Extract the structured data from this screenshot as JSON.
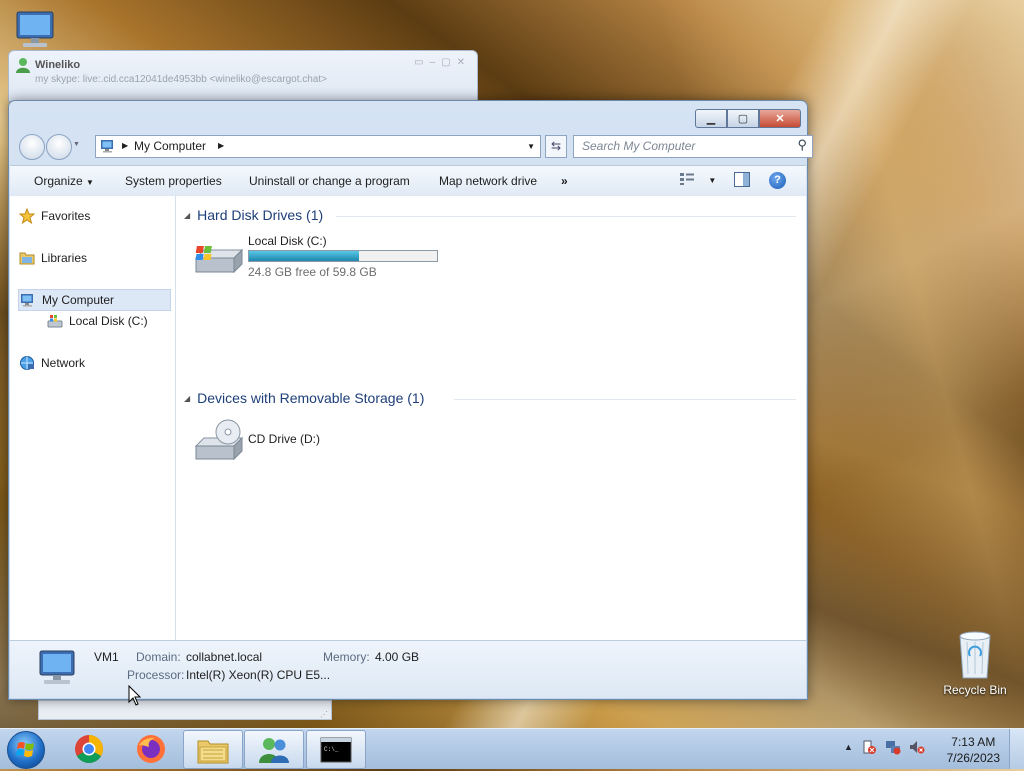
{
  "desktop": {
    "icons": [
      {
        "label": "Recycle Bin"
      }
    ]
  },
  "chat_window": {
    "name": "Wineliko",
    "subtitle": "my skype: live:.cid.cca12041de4953bb <wineliko@escargot.chat>"
  },
  "explorer": {
    "address": {
      "crumb": "My Computer"
    },
    "search": {
      "placeholder": "Search My Computer"
    },
    "toolbar": {
      "organize": "Organize",
      "system_properties": "System properties",
      "uninstall": "Uninstall or change a program",
      "map_drive": "Map network drive",
      "more": "»"
    },
    "nav": {
      "favorites": "Favorites",
      "libraries": "Libraries",
      "my_computer": "My Computer",
      "local_disk": "Local Disk (C:)",
      "network": "Network"
    },
    "groups": {
      "hard_disk": "Hard Disk Drives (1)",
      "removable": "Devices with Removable Storage (1)"
    },
    "drives": {
      "c_name": "Local Disk (C:)",
      "c_free": "24.8 GB free of 59.8 GB",
      "c_used_fraction": 0.585,
      "d_name": "CD Drive (D:)"
    },
    "details": {
      "computer_name": "VM1",
      "domain_label": "Domain:",
      "domain_value": "collabnet.local",
      "memory_label": "Memory:",
      "memory_value": "4.00 GB",
      "processor_label": "Processor:",
      "processor_value": "Intel(R) Xeon(R) CPU E5..."
    }
  },
  "taskbar": {
    "apps": [
      "chrome-icon",
      "firefox-icon",
      "explorer-icon",
      "messenger-icon",
      "cmd-icon"
    ],
    "time": "7:13 AM",
    "date": "7/26/2023"
  },
  "colors": {
    "accent": "#1e3f79",
    "drive_fill": "#1e86ae",
    "close_button": "#c64a34"
  }
}
